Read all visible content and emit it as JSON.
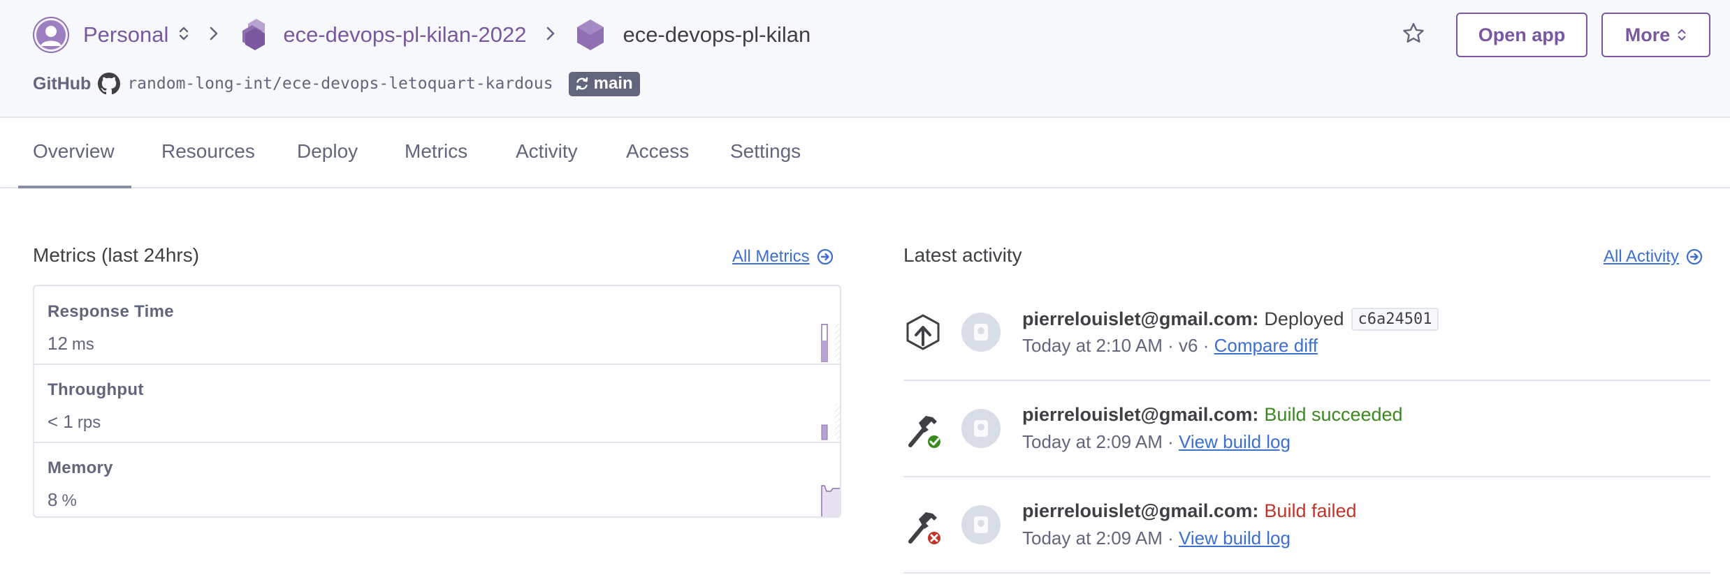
{
  "breadcrumb": {
    "account": "Personal",
    "pipeline": "ece-devops-pl-kilan-2022",
    "app": "ece-devops-pl-kilan"
  },
  "repo": {
    "provider": "GitHub",
    "name": "random-long-int/ece-devops-letoquart-kardous",
    "branch": "main"
  },
  "header_actions": {
    "open_app": "Open app",
    "more": "More"
  },
  "tabs": [
    {
      "label": "Overview",
      "active": true
    },
    {
      "label": "Resources",
      "active": false
    },
    {
      "label": "Deploy",
      "active": false
    },
    {
      "label": "Metrics",
      "active": false
    },
    {
      "label": "Activity",
      "active": false
    },
    {
      "label": "Access",
      "active": false
    },
    {
      "label": "Settings",
      "active": false
    }
  ],
  "metrics": {
    "title": "Metrics (last 24hrs)",
    "all_link": "All Metrics",
    "items": [
      {
        "label": "Response Time",
        "value": "12",
        "unit": "ms"
      },
      {
        "label": "Throughput",
        "value": "< 1",
        "unit": "rps"
      },
      {
        "label": "Memory",
        "value": "8",
        "unit": "%"
      }
    ]
  },
  "activity": {
    "title": "Latest activity",
    "all_link": "All Activity",
    "items": [
      {
        "icon": "deploy-upload-icon",
        "user": "pierrelouislet@gmail.com:",
        "verb": "Deployed",
        "status": "neutral",
        "commit": "c6a24501",
        "time": "Today at 2:10 AM · v6 · ",
        "link": "Compare diff"
      },
      {
        "icon": "build-succeeded-icon",
        "user": "pierrelouislet@gmail.com:",
        "verb": "Build succeeded",
        "status": "success",
        "time": "Today at 2:09 AM · ",
        "link": "View build log"
      },
      {
        "icon": "build-failed-icon",
        "user": "pierrelouislet@gmail.com:",
        "verb": "Build failed",
        "status": "fail",
        "time": "Today at 2:09 AM · ",
        "link": "View build log"
      }
    ]
  },
  "colors": {
    "brand_purple": "#79589f",
    "link_blue": "#3c6fd0",
    "success_green": "#3a8a1f",
    "fail_red": "#c2332a",
    "header_bg": "#f7f8fb"
  }
}
